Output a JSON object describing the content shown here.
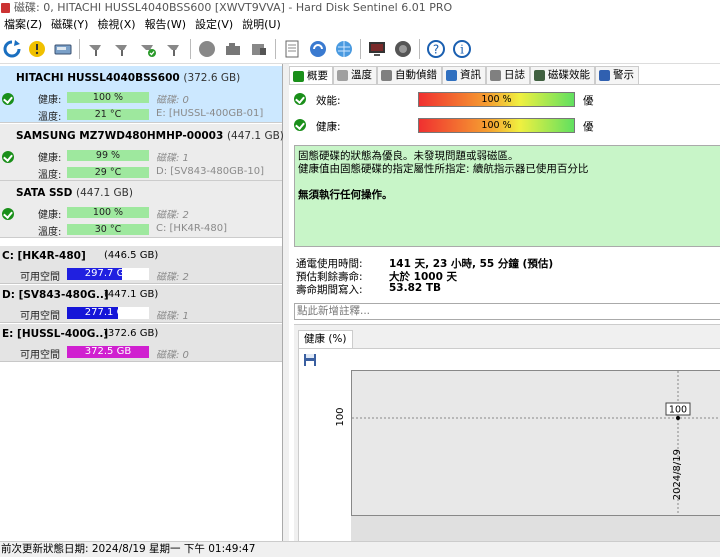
{
  "title": "磁碟: 0, HITACHI HUSSL4040BSS600 [XWVT9VVA]  -  Hard Disk Sentinel 6.01 PRO",
  "menu": [
    "檔案(Z)",
    "磁碟(Y)",
    "檢視(X)",
    "報告(W)",
    "設定(V)",
    "說明(U)"
  ],
  "toolbar_icons": [
    "refresh-icon",
    "warning-icon",
    "disk-icon",
    "probe-icon",
    "probe-icon-2",
    "check-icon",
    "probe-icon-3",
    "circle-icon",
    "camera-icon",
    "drive-icon",
    "document-icon",
    "sync-icon",
    "globe-icon",
    "monitor-icon",
    "speaker-icon",
    "help-icon",
    "info-icon"
  ],
  "labels": {
    "health": "健康:",
    "temp": "溫度:",
    "free": "可用空間"
  },
  "disks": [
    {
      "name": "HITACHI HUSSL4040BSS600",
      "size": "(372.6 GB)",
      "health": "100 %",
      "disk_label": "磁碟: 0",
      "temp": "21 °C",
      "vol": "E: [HUSSL-400GB-01]"
    },
    {
      "name": "SAMSUNG MZ7WD480HMHP-00003",
      "size": "(447.1 GB)",
      "health": "99 %",
      "disk_label": "磁碟: 1",
      "temp": "29 °C",
      "vol": "D: [SV843-480GB-10]"
    },
    {
      "name": "SATA SSD",
      "size": "(447.1 GB)",
      "health": "100 %",
      "disk_label": "磁碟: 2",
      "temp": "30 °C",
      "vol": "C: [HK4R-480]"
    }
  ],
  "volumes": [
    {
      "name": "C: [HK4R-480]",
      "size": "(446.5 GB)",
      "free": "297.7 GB",
      "free_fraction": 0.67,
      "disk": "磁碟: 2",
      "color": "#2020e0"
    },
    {
      "name": "D: [SV843-480G..]",
      "size": "(447.1 GB)",
      "free": "277.1 GB",
      "free_fraction": 0.62,
      "disk": "磁碟: 1",
      "color": "#1515d8"
    },
    {
      "name": "E: [HUSSL-400G..]",
      "size": "(372.6 GB)",
      "free": "372.5 GB",
      "free_fraction": 1.0,
      "disk": "磁碟: 0",
      "color": "#d020d0"
    }
  ],
  "tabs": [
    {
      "label": "概要",
      "icon": "overview-icon",
      "color": "#1a8f1a"
    },
    {
      "label": "溫度",
      "icon": "thermometer-icon",
      "color": "#a0a0a0"
    },
    {
      "label": "自動偵錯",
      "icon": "smart-icon",
      "color": "#808080"
    },
    {
      "label": "資訊",
      "icon": "info-tab-icon",
      "color": "#3070c0"
    },
    {
      "label": "日誌",
      "icon": "log-icon",
      "color": "#808080"
    },
    {
      "label": "磁碟效能",
      "icon": "performance-icon",
      "color": "#406040"
    },
    {
      "label": "警示",
      "icon": "alert-icon",
      "color": "#3060b0"
    }
  ],
  "overview": {
    "performance_label": "效能:",
    "performance_value": "100 %",
    "performance_rating": "優",
    "health_label": "健康:",
    "health_value": "100 %",
    "health_rating": "優",
    "message_line1": "固態硬碟的狀態為優良。未發現問題或弱磁區。",
    "message_line2": "健康值由固態硬碟的指定屬性所指定: 續航指示器已使用百分比",
    "message_strong": "無須執行任何操作。",
    "power_on_label": "通電使用時間:",
    "power_on_value": "141 天, 23 小時, 55 分鐘 (預估)",
    "lifetime_label": "預估剩餘壽命:",
    "lifetime_value": "大於 1000 天",
    "written_label": "壽命期間寫入:",
    "written_value": "53.82 TB",
    "notes_placeholder": "點此新增註釋..."
  },
  "chart_data": {
    "type": "line",
    "title": "健康 (%)",
    "x": [
      "2024/8/19"
    ],
    "series": [
      {
        "values": [
          100
        ]
      }
    ],
    "ylabel": "",
    "yticks": [
      "100"
    ],
    "data_labels": [
      "100"
    ]
  },
  "status": "前次更新狀態日期: 2024/8/19 星期一 下午 01:49:47"
}
